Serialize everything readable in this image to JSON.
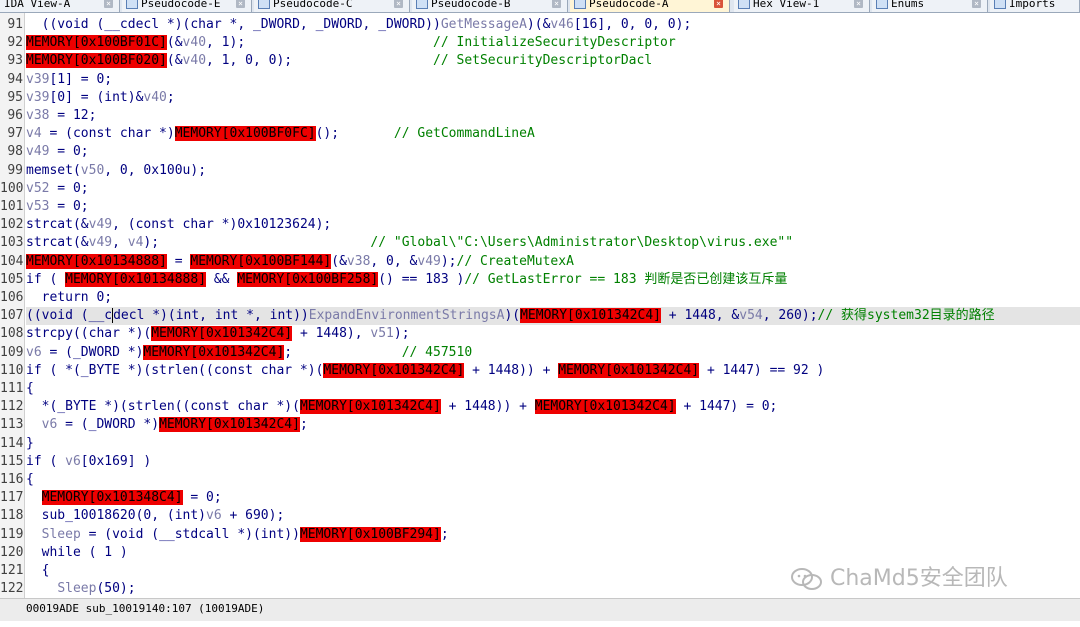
{
  "tabs": [
    {
      "label": "IDA View-A",
      "active": false
    },
    {
      "label": "Pseudocode-E",
      "active": false
    },
    {
      "label": "Pseudocode-C",
      "active": false
    },
    {
      "label": "Pseudocode-B",
      "active": false
    },
    {
      "label": "Pseudocode-A",
      "active": true
    },
    {
      "label": "Hex View-1",
      "active": false
    },
    {
      "label": "Enums",
      "active": false
    },
    {
      "label": "Imports",
      "active": false
    }
  ],
  "line_numbers": [
    "91",
    "92",
    "93",
    "94",
    "95",
    "96",
    "97",
    "98",
    "99",
    "100",
    "101",
    "102",
    "103",
    "104",
    "105",
    "106",
    "107",
    "108",
    "109",
    "110",
    "111",
    "112",
    "113",
    "114",
    "115",
    "116",
    "117",
    "118",
    "119",
    "120",
    "121",
    "122"
  ],
  "code": {
    "l91": [
      "  ((void (__cdecl *)(char *, _DWORD, _DWORD, _DWORD))",
      "GetMessageA",
      ")(&",
      "v46",
      "[16], 0, 0, 0);"
    ],
    "l92": [
      "MEMORY[0x100BF01C]",
      "(&",
      "v40",
      ", 1);",
      "                        ",
      "// InitializeSecurityDescriptor"
    ],
    "l93": [
      "MEMORY[0x100BF020]",
      "(&",
      "v40",
      ", 1, 0, 0);",
      "                  ",
      "// SetSecurityDescriptorDacl"
    ],
    "l94": [
      "v39",
      "[1] = 0;"
    ],
    "l95": [
      "v39",
      "[0] = (int)&",
      "v40",
      ";"
    ],
    "l96": [
      "v38",
      " = 12;"
    ],
    "l97": [
      "v4",
      " = (const char *)",
      "MEMORY[0x100BF0FC]",
      "();",
      "       ",
      "// GetCommandLineA"
    ],
    "l98": [
      "v49",
      " = 0;"
    ],
    "l99": [
      "memset(",
      "v50",
      ", 0, 0x100u);"
    ],
    "l100": [
      "v52",
      " = 0;"
    ],
    "l101": [
      "v53",
      " = 0;"
    ],
    "l102": [
      "strcat(&",
      "v49",
      ", (const char *)0x10123624);"
    ],
    "l103": [
      "strcat(&",
      "v49",
      ", ",
      "v4",
      ");",
      "                           ",
      "// \"Global\\\"C:\\Users\\Administrator\\Desktop\\virus.exe\"\""
    ],
    "l104": [
      "MEMORY[0x10134888]",
      " = ",
      "MEMORY[0x100BF144]",
      "(&",
      "v38",
      ", 0, &",
      "v49",
      ");",
      "// CreateMutexA"
    ],
    "l105": [
      "if ( ",
      "MEMORY[0x10134888]",
      " && ",
      "MEMORY[0x100BF258]",
      "() == 183 )",
      "// GetLastError == 183 判断是否已创建该互斥量"
    ],
    "l106": [
      "  return 0;"
    ],
    "l107": [
      "((void (__c",
      "decl *)(int, int *, int))",
      "ExpandEnvironmentStringsA",
      ")(",
      "MEMORY[0x101342C4]",
      " + 1448, &",
      "v54",
      ", 260);",
      "// 获得system32目录的路径"
    ],
    "l108": [
      "strcpy((char *)(",
      "MEMORY[0x101342C4]",
      " + 1448), ",
      "v51",
      ");"
    ],
    "l109": [
      "v6",
      " = (_DWORD *)",
      "MEMORY[0x101342C4]",
      ";",
      "              ",
      "// 457510"
    ],
    "l110": [
      "if ( *(_BYTE *)(strlen((const char *)(",
      "MEMORY[0x101342C4]",
      " + 1448)) + ",
      "MEMORY[0x101342C4]",
      " + 1447) == 92 )"
    ],
    "l111": [
      "{"
    ],
    "l112": [
      "  *(_BYTE *)(strlen((const char *)(",
      "MEMORY[0x101342C4]",
      " + 1448)) + ",
      "MEMORY[0x101342C4]",
      " + 1447) = 0;"
    ],
    "l113": [
      "  ",
      "v6",
      " = (_DWORD *)",
      "MEMORY[0x101342C4]",
      ";"
    ],
    "l114": [
      "}"
    ],
    "l115": [
      "if ( ",
      "v6",
      "[0x169] )"
    ],
    "l116": [
      "{"
    ],
    "l117": [
      "  ",
      "MEMORY[0x101348C4]",
      " = 0;"
    ],
    "l118": [
      "  sub_10018620(0, (int)",
      "v6",
      " + 690);"
    ],
    "l119": [
      "  ",
      "Sleep",
      " = (void (__stdcall *)(int))",
      "MEMORY[0x100BF294]",
      ";"
    ],
    "l120": [
      "  while ( 1 )"
    ],
    "l121": [
      "  {"
    ],
    "l122": [
      "    ",
      "Sleep",
      "(50);"
    ]
  },
  "status": {
    "text": "00019ADE sub_10019140:107 (10019ADE)"
  },
  "watermark": {
    "text": "ChaMd5安全团队"
  },
  "colors": {
    "highlight": "#ee0000",
    "comment": "#008000",
    "keyword": "#000080",
    "variable": "#7a7aa8"
  }
}
